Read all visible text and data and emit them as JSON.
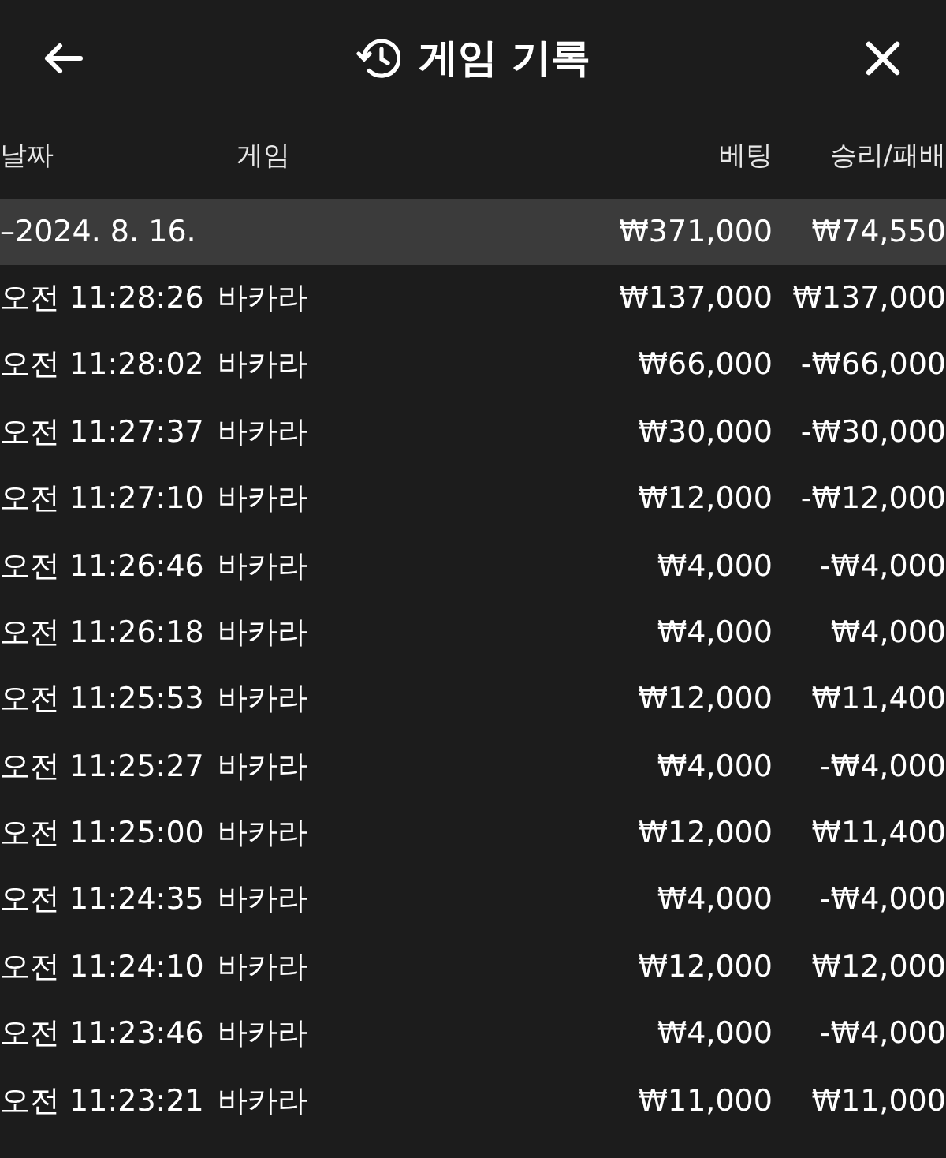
{
  "header": {
    "title": "게임 기록"
  },
  "columns": [
    "날짜",
    "게임",
    "베팅",
    "승리/패배"
  ],
  "date_group": {
    "date": "–2024. 8. 16.",
    "bet": "₩371,000",
    "result": "₩74,550"
  },
  "rows": [
    {
      "time": "오전 11:28:26",
      "game": "바카라",
      "bet": "₩137,000",
      "result": "₩137,000"
    },
    {
      "time": "오전 11:28:02",
      "game": "바카라",
      "bet": "₩66,000",
      "result": "-₩66,000"
    },
    {
      "time": "오전 11:27:37",
      "game": "바카라",
      "bet": "₩30,000",
      "result": "-₩30,000"
    },
    {
      "time": "오전 11:27:10",
      "game": "바카라",
      "bet": "₩12,000",
      "result": "-₩12,000"
    },
    {
      "time": "오전 11:26:46",
      "game": "바카라",
      "bet": "₩4,000",
      "result": "-₩4,000"
    },
    {
      "time": "오전 11:26:18",
      "game": "바카라",
      "bet": "₩4,000",
      "result": "₩4,000"
    },
    {
      "time": "오전 11:25:53",
      "game": "바카라",
      "bet": "₩12,000",
      "result": "₩11,400"
    },
    {
      "time": "오전 11:25:27",
      "game": "바카라",
      "bet": "₩4,000",
      "result": "-₩4,000"
    },
    {
      "time": "오전 11:25:00",
      "game": "바카라",
      "bet": "₩12,000",
      "result": "₩11,400"
    },
    {
      "time": "오전 11:24:35",
      "game": "바카라",
      "bet": "₩4,000",
      "result": "-₩4,000"
    },
    {
      "time": "오전 11:24:10",
      "game": "바카라",
      "bet": "₩12,000",
      "result": "₩12,000"
    },
    {
      "time": "오전 11:23:46",
      "game": "바카라",
      "bet": "₩4,000",
      "result": "-₩4,000"
    },
    {
      "time": "오전 11:23:21",
      "game": "바카라",
      "bet": "₩11,000",
      "result": "₩11,000"
    }
  ]
}
